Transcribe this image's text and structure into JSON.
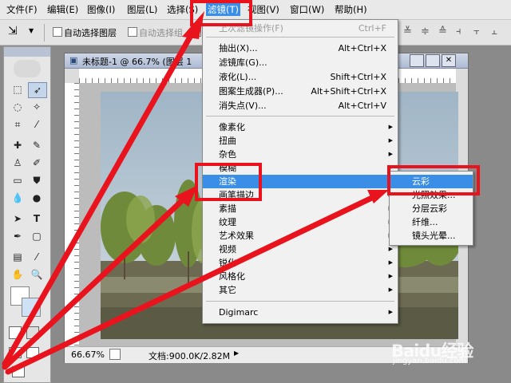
{
  "menubar": {
    "items": [
      "文件(F)",
      "编辑(E)",
      "图像(I)",
      "图层(L)",
      "选择(S)",
      "滤镜(T)",
      "视图(V)",
      "窗口(W)",
      "帮助(H)"
    ]
  },
  "options_bar": {
    "auto_select_layer": "自动选择图层",
    "auto_select_group": "自动选择组"
  },
  "document": {
    "title": "未标题-1 @ 66.7% (图层 1",
    "zoom": "66.67%",
    "doc_info": "文档:900.0K/2.82M"
  },
  "filter_menu": {
    "items": [
      {
        "label": "上次滤镜操作(F)",
        "shortcut": "Ctrl+F",
        "disabled": true
      },
      {
        "label": "抽出(X)...",
        "shortcut": "Alt+Ctrl+X"
      },
      {
        "label": "滤镜库(G)...",
        "shortcut": ""
      },
      {
        "label": "液化(L)...",
        "shortcut": "Shift+Ctrl+X"
      },
      {
        "label": "图案生成器(P)...",
        "shortcut": "Alt+Shift+Ctrl+X"
      },
      {
        "label": "消失点(V)...",
        "shortcut": "Alt+Ctrl+V"
      },
      {
        "label": "像素化",
        "submenu": true
      },
      {
        "label": "扭曲",
        "submenu": true
      },
      {
        "label": "杂色",
        "submenu": true
      },
      {
        "label": "模糊",
        "submenu": true
      },
      {
        "label": "渲染",
        "submenu": true,
        "highlighted": true
      },
      {
        "label": "画笔描边",
        "submenu": true
      },
      {
        "label": "素描",
        "submenu": true
      },
      {
        "label": "纹理",
        "submenu": true
      },
      {
        "label": "艺术效果",
        "submenu": true
      },
      {
        "label": "视频",
        "submenu": true
      },
      {
        "label": "锐化",
        "submenu": true
      },
      {
        "label": "风格化",
        "submenu": true
      },
      {
        "label": "其它",
        "submenu": true
      },
      {
        "label": "Digimarc",
        "submenu": true
      }
    ]
  },
  "render_submenu": {
    "items": [
      "云彩",
      "光照效果...",
      "分层云彩",
      "纤维...",
      "镜头光晕..."
    ]
  },
  "watermark": {
    "brand": "Baidu经验",
    "url": "jingyan.baidu.com"
  },
  "colors": {
    "highlight": "#3a8ee6",
    "annotation_red": "#e8131d"
  }
}
